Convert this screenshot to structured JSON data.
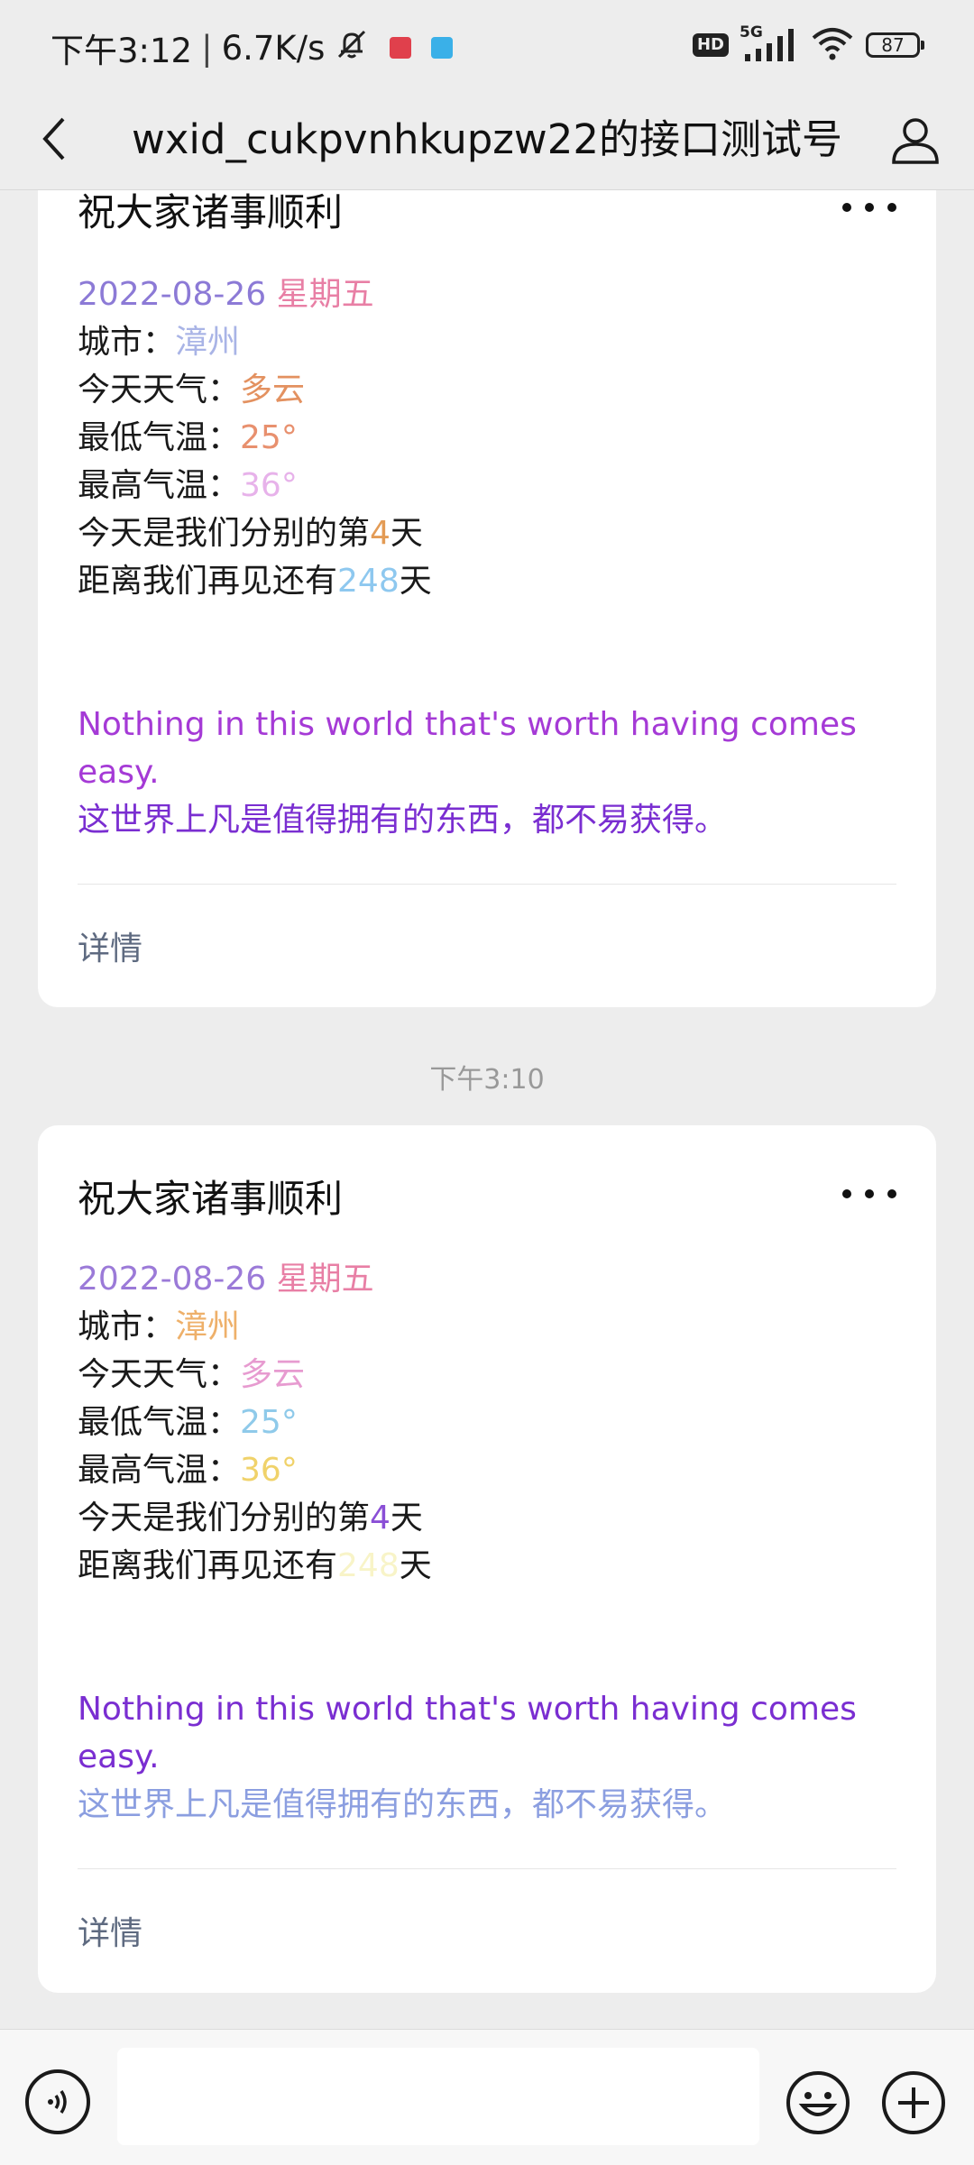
{
  "status_bar": {
    "time": "下午3:12",
    "separator": "|",
    "net_speed": "6.7K/s",
    "network": "5G",
    "battery": "87",
    "hd": "HD"
  },
  "header": {
    "title": "wxid_cukpvnhkupzw22的接口测试号",
    "back_icon": "chevron-left-icon",
    "profile_icon": "person-icon"
  },
  "messages": [
    {
      "title": "祝大家诸事顺利",
      "date": "2022-08-26",
      "weekday": "星期五",
      "city_label": "城市：",
      "city": "漳州",
      "weather_label": "今天天气：",
      "weather": "多云",
      "low_label": "最低气温：",
      "low": "25°",
      "high_label": "最高气温：",
      "high": "36°",
      "apart_prefix": "今天是我们分别的第",
      "apart_days": "4",
      "apart_suffix": "天",
      "meet_prefix": "距离我们再见还有",
      "meet_days": "248",
      "meet_suffix": "天",
      "quote_en": "Nothing in this world that's worth having comes easy.",
      "quote_zh": "这世界上凡是值得拥有的东西，都不易获得。",
      "details": "详情",
      "colors": {
        "date": "#8c7ad6",
        "weekday": "#e87fa5",
        "city": "#a9b4e6",
        "weather": "#e39160",
        "low": "#e8906e",
        "high": "#e7b2ea",
        "apart": "#e39b55",
        "meet": "#8ec8ef",
        "quote_en": "#a53ad6",
        "quote_zh": "#7a2ed1"
      }
    },
    {
      "title": "祝大家诸事顺利",
      "date": "2022-08-26",
      "weekday": "星期五",
      "city_label": "城市：",
      "city": "漳州",
      "weather_label": "今天天气：",
      "weather": "多云",
      "low_label": "最低气温：",
      "low": "25°",
      "high_label": "最高气温：",
      "high": "36°",
      "apart_prefix": "今天是我们分别的第",
      "apart_days": "4",
      "apart_suffix": "天",
      "meet_prefix": "距离我们再见还有",
      "meet_days": "248",
      "meet_suffix": "天",
      "quote_en": "Nothing in this world that's worth having comes easy.",
      "quote_zh": "这世界上凡是值得拥有的东西，都不易获得。",
      "details": "详情",
      "colors": {
        "date": "#9b7ad8",
        "weekday": "#e87fa5",
        "city": "#eeb06a",
        "weather": "#e79bd0",
        "low": "#8fcaea",
        "high": "#f0d26a",
        "apart": "#8a4fd6",
        "meet": "#f8f4c8",
        "quote_en": "#7a2ed1",
        "quote_zh": "#8b9ee0"
      }
    }
  ],
  "timestamp": "下午3:10",
  "input": {
    "voice_icon": "voice-icon",
    "emoji_icon": "emoji-icon",
    "plus_icon": "plus-icon",
    "placeholder": ""
  }
}
